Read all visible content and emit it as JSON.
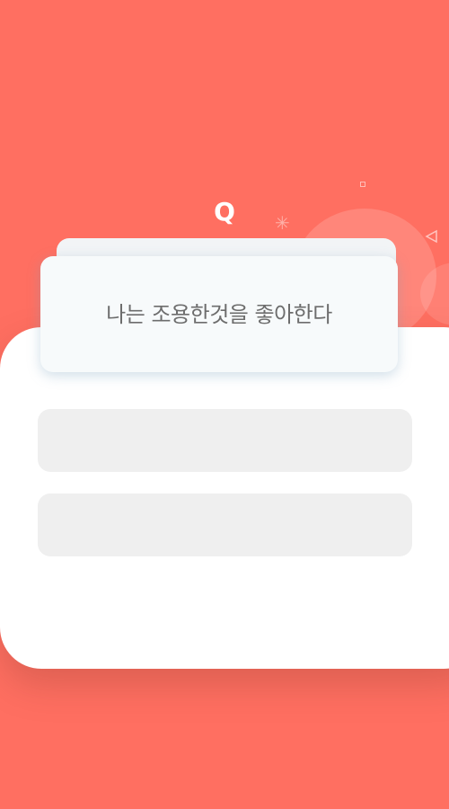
{
  "question": {
    "marker": "Q",
    "text": "나는 조용한것을 좋아한다"
  },
  "answers": [
    {
      "label": ""
    },
    {
      "label": ""
    }
  ],
  "colors": {
    "background": "#ff6f61",
    "panel": "#ffffff",
    "card": "#f7fafb",
    "answer_button": "#efefef",
    "question_text": "#6d6d6d"
  },
  "icons": [
    "sparkle-icon",
    "square-outline-icon",
    "triangle-outline-icon"
  ]
}
